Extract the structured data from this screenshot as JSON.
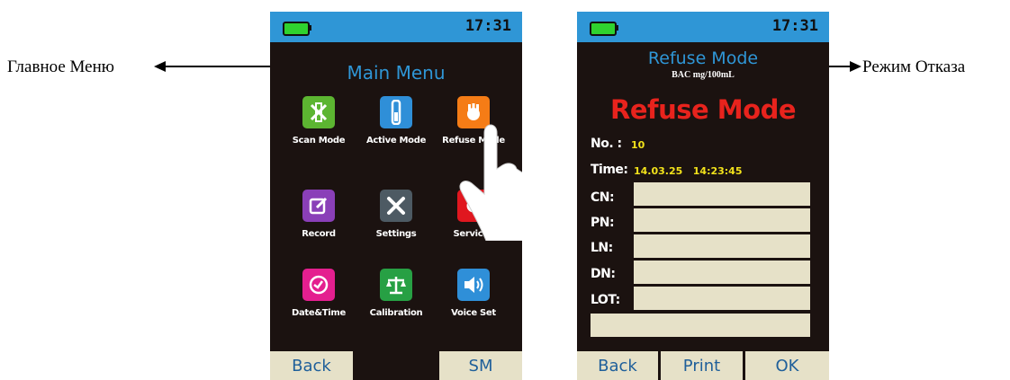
{
  "left_callout": "Главное Меню",
  "right_callout": "Режим Отказа",
  "main_menu": {
    "status_time": "17:31",
    "title": "Main Menu",
    "tiles": [
      {
        "label": "Scan Mode",
        "icon": "scan-icon",
        "color": "#5cb531"
      },
      {
        "label": "Active Mode",
        "icon": "active-mode-icon",
        "color": "#2f8fd8"
      },
      {
        "label": "Refuse Mode",
        "icon": "hand-icon",
        "color": "#f57c16"
      },
      {
        "label": "Record",
        "icon": "edit-icon",
        "color": "#8a3fb8"
      },
      {
        "label": "Settings",
        "icon": "tools-icon",
        "color": "#4d5a63"
      },
      {
        "label": "Services",
        "icon": "gear-icon",
        "color": "#e0171f"
      },
      {
        "label": "Date&Time",
        "icon": "clock-icon",
        "color": "#e41f8f"
      },
      {
        "label": "Calibration",
        "icon": "scale-icon",
        "color": "#27a044"
      },
      {
        "label": "Voice Set",
        "icon": "speaker-icon",
        "color": "#2f8fd8"
      }
    ],
    "back": "Back",
    "sm": "SM"
  },
  "refuse_mode": {
    "status_time": "17:31",
    "title": "Refuse Mode",
    "subtitle": "BAC mg/100mL",
    "big_title": "Refuse Mode",
    "no_label": "No. :",
    "no_value": "10",
    "time_label": "Time:",
    "time_value": "14.03.25   14:23:45",
    "fields": [
      "CN:",
      "PN:",
      "LN:",
      "DN:",
      "LOT:"
    ],
    "back": "Back",
    "print": "Print",
    "ok": "OK"
  },
  "colors": {
    "statusbar": "#2f96d6",
    "screen_bg": "#1b1210",
    "button_bg": "#e6e1c8",
    "button_text": "#1f5f9a",
    "refuse_red": "#e8231d",
    "value_yellow": "#f2e21b"
  }
}
